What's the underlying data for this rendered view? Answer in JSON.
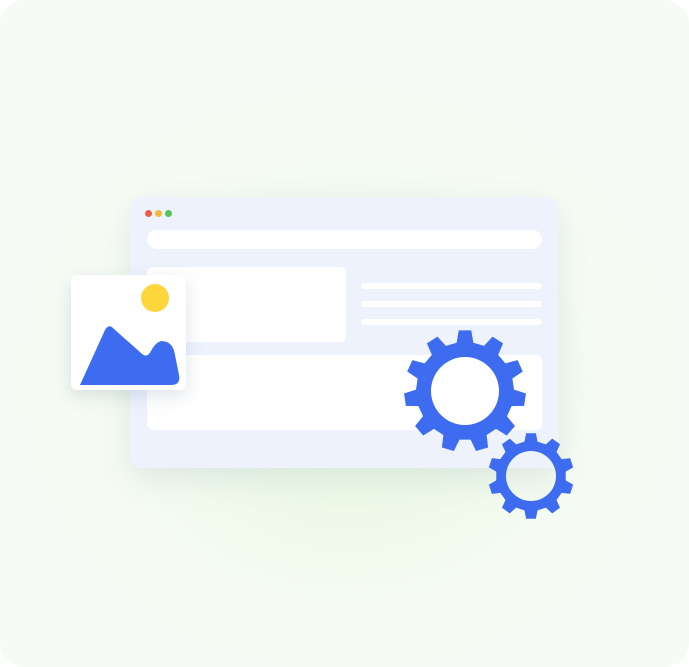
{
  "colors": {
    "window_bg": "#edf2fd",
    "placeholder": "#ffffff",
    "accent_blue": "#3d6cf0",
    "sun_yellow": "#fcd63a",
    "dot_red": "#ed5b4b",
    "dot_yellow": "#f4b839",
    "dot_green": "#5cc15a"
  },
  "icons": {
    "image": "image-icon",
    "mountain": "mountain-icon",
    "sun": "sun-icon",
    "gear_large": "gear-icon",
    "gear_small": "gear-icon"
  }
}
